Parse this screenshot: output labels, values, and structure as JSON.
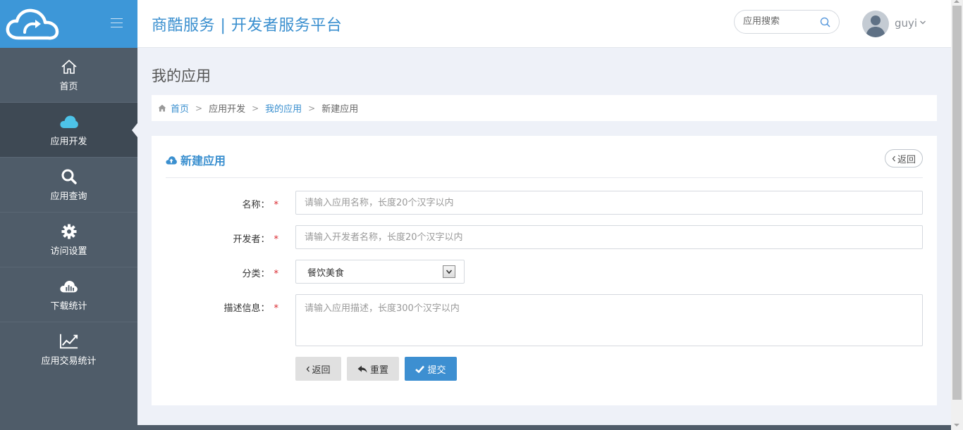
{
  "header": {
    "title": "商酷服务 | 开发者服务平台",
    "search_placeholder": "应用搜索",
    "user_name": "guyi"
  },
  "sidebar": {
    "items": [
      {
        "label": "首页",
        "icon": "home-icon"
      },
      {
        "label": "应用开发",
        "icon": "cloud-icon",
        "active": true
      },
      {
        "label": "应用查询",
        "icon": "search-icon"
      },
      {
        "label": "访问设置",
        "icon": "gear-icon"
      },
      {
        "label": "下载统计",
        "icon": "cloud-chart-icon"
      },
      {
        "label": "应用交易统计",
        "icon": "line-chart-icon"
      }
    ]
  },
  "page": {
    "title": "我的应用"
  },
  "breadcrumb": {
    "items": [
      "首页",
      "应用开发",
      "我的应用",
      "新建应用"
    ],
    "separator": ">"
  },
  "panel": {
    "title": "新建应用",
    "back_label": "返回"
  },
  "form": {
    "name_label": "名称：",
    "name_placeholder": "请输入应用名称，长度20个汉字以内",
    "developer_label": "开发者：",
    "developer_placeholder": "请输入开发者名称，长度20个汉字以内",
    "category_label": "分类：",
    "category_value": "餐饮美食",
    "description_label": "描述信息：",
    "description_placeholder": "请输入应用描述，长度300个汉字以内",
    "required_mark": "*"
  },
  "buttons": {
    "back": "返回",
    "reset": "重置",
    "submit": "提交"
  },
  "colors": {
    "brand": "#3d97d8",
    "sidebar": "#4f5c69",
    "sidebar_active": "#3e4954",
    "submit": "#3d8fd1",
    "required": "#d9262c"
  }
}
